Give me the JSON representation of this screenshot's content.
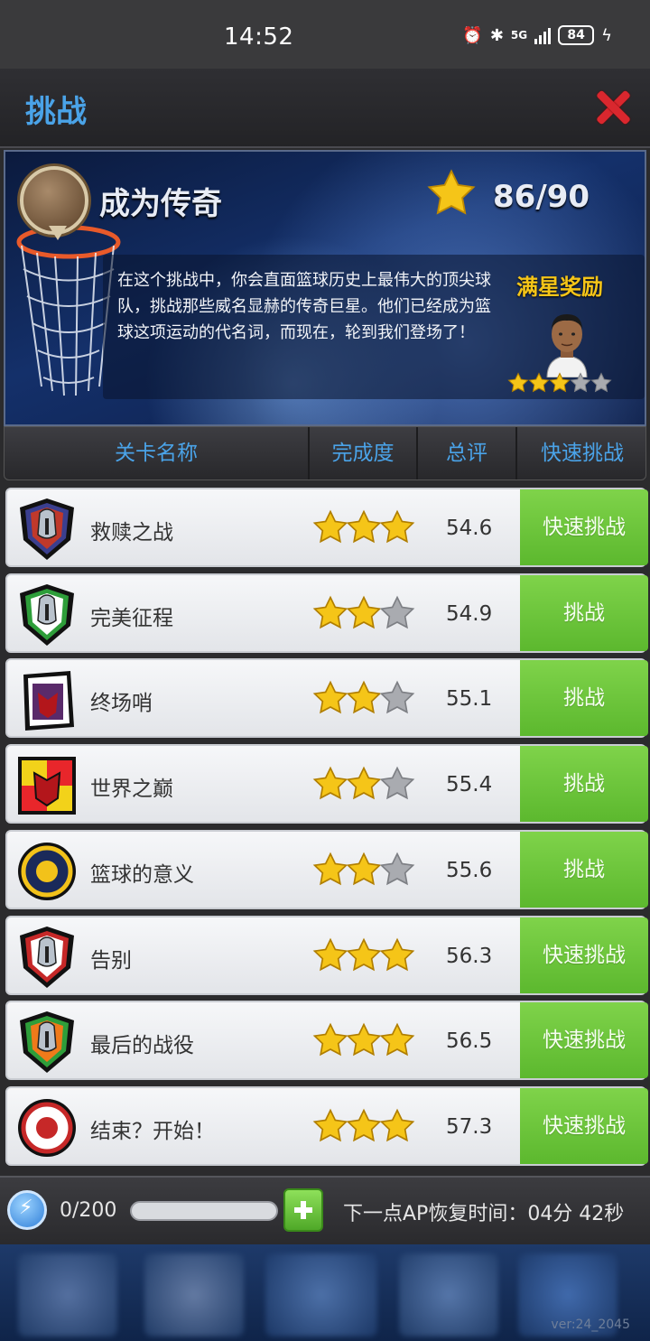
{
  "status_bar": {
    "time": "14:52",
    "network": "5G",
    "battery": "84"
  },
  "header": {
    "title": "挑战",
    "close_icon": "close-icon"
  },
  "banner": {
    "title": "成为传奇",
    "score": "86/90",
    "description": "在这个挑战中，你会直面篮球历史上最伟大的顶尖球队，挑战那些威名显赫的传奇巨星。他们已经成为篮球这项运动的代名词，而现在，轮到我们登场了！",
    "reward_label": "满星奖励",
    "reward_stars": 3,
    "reward_stars_max": 5
  },
  "table": {
    "headers": [
      "关卡名称",
      "完成度",
      "总评",
      "快速挑战"
    ],
    "rows": [
      {
        "name": "救赎之战",
        "stars": 3,
        "rating": "54.6",
        "button": "快速挑战",
        "logo": "spartan-helmet-red-blue"
      },
      {
        "name": "完美征程",
        "stars": 2,
        "rating": "54.9",
        "button": "挑战",
        "logo": "spartan-helmet-green"
      },
      {
        "name": "终场哨",
        "stars": 2,
        "rating": "55.1",
        "button": "挑战",
        "logo": "wolf-purple"
      },
      {
        "name": "世界之巅",
        "stars": 2,
        "rating": "55.4",
        "button": "挑战",
        "logo": "wolf-red-yellow"
      },
      {
        "name": "篮球的意义",
        "stars": 2,
        "rating": "55.6",
        "button": "挑战",
        "logo": "gear-navy-yellow"
      },
      {
        "name": "告别",
        "stars": 3,
        "rating": "56.3",
        "button": "快速挑战",
        "logo": "spartan-helmet-red"
      },
      {
        "name": "最后的战役",
        "stars": 3,
        "rating": "56.5",
        "button": "快速挑战",
        "logo": "spartan-helmet-orange-green"
      },
      {
        "name": "结束？开始！",
        "stars": 3,
        "rating": "57.3",
        "button": "快速挑战",
        "logo": "bull-red"
      }
    ]
  },
  "ap_bar": {
    "count": "0/200",
    "progress": 0,
    "recover_text": "下一点AP恢复时间：04分 42秒"
  },
  "footer": {
    "version": "ver:24_2045"
  },
  "colors": {
    "accent_blue": "#4aa3e8",
    "button_green": "#6cc63a",
    "star_gold": "#f5c518",
    "close_red": "#d9272e"
  }
}
